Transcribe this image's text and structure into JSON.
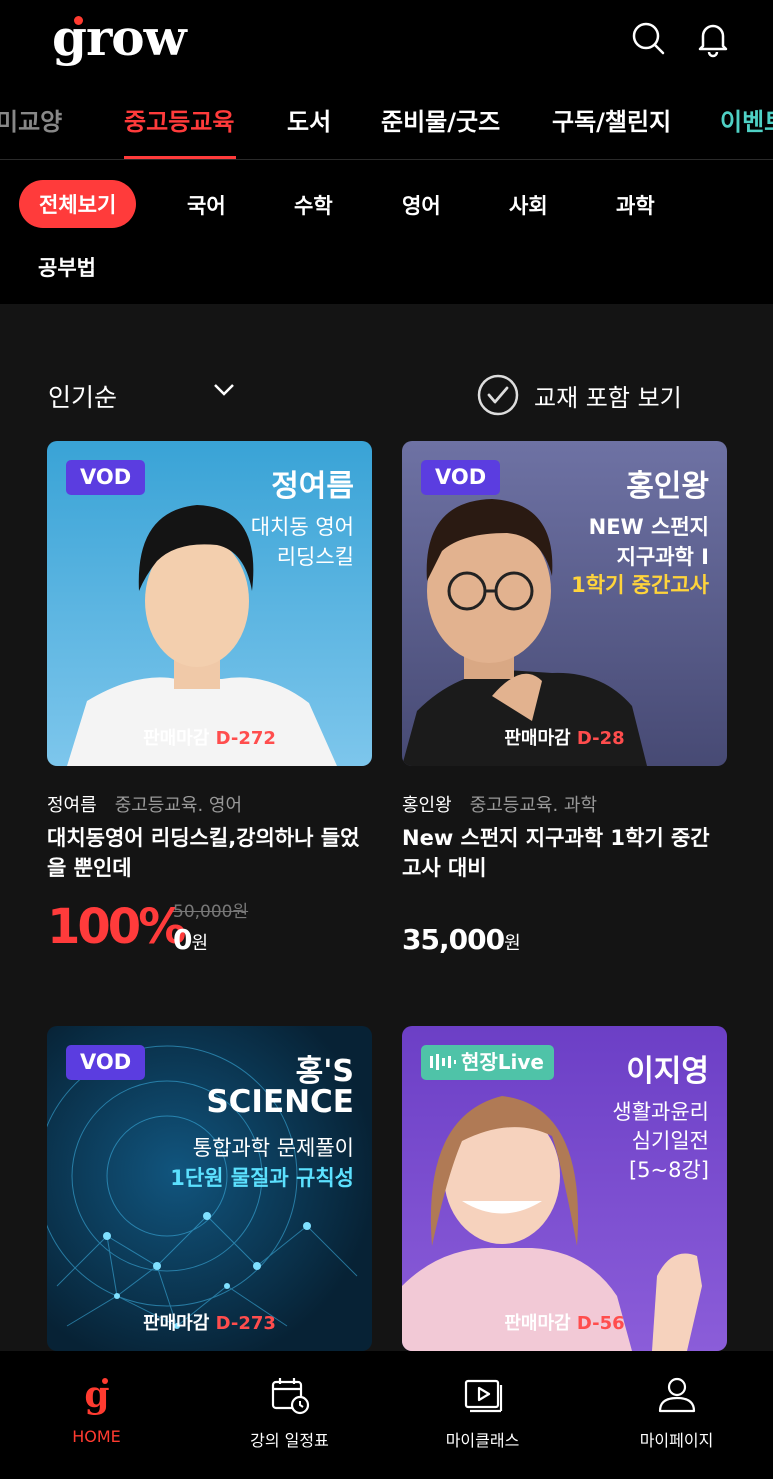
{
  "header": {
    "logo": "grow",
    "icons": [
      "search-icon",
      "bell-icon"
    ]
  },
  "category_tabs": [
    {
      "label": "미교양",
      "state": "dim"
    },
    {
      "label": "중고등교육",
      "state": "active"
    },
    {
      "label": "도서",
      "state": "normal"
    },
    {
      "label": "준비물/굿즈",
      "state": "normal"
    },
    {
      "label": "구독/챌린지",
      "state": "normal"
    },
    {
      "label": "이벤트",
      "state": "event"
    }
  ],
  "subject_chips": [
    "전체보기",
    "국어",
    "수학",
    "영어",
    "사회",
    "과학",
    "공부법"
  ],
  "filters": {
    "sort_label": "인기순",
    "include_textbook_label": "교재 포함 보기"
  },
  "products": [
    {
      "badge": "VOD",
      "thumb_name": "정여름",
      "thumb_lines": [
        "대치동 영어",
        "리딩스킬"
      ],
      "deadline_label": "판매마감",
      "deadline": "D-272",
      "instructor": "정여름",
      "category": "중고등교육. 영어",
      "title": "대치동영어 리딩스킬,강의하나 들었을 뿐인데",
      "discount": "100%",
      "original_price": "50,000원",
      "price": "0",
      "currency": "원",
      "colors": {
        "bg_top": "#3fa9d8",
        "bg_bottom": "#7cc8ee"
      }
    },
    {
      "badge": "VOD",
      "thumb_name": "홍인왕",
      "thumb_lines": [
        "NEW 스펀지",
        "지구과학 I",
        "1학기 중간고사"
      ],
      "deadline_label": "판매마감",
      "deadline": "D-28",
      "instructor": "홍인왕",
      "category": "중고등교육. 과학",
      "title": "New 스펀지 지구과학 1학기 중간고사 대비",
      "price": "35,000",
      "currency": "원",
      "colors": {
        "bg_top": "#6a6d9e",
        "bg_bottom": "#4a4c78"
      }
    },
    {
      "badge": "VOD",
      "thumb_name": "홍'S",
      "thumb_lines": [
        "SCIENCE",
        "통합과학 문제풀이",
        "1단원 물질과 규칙성"
      ],
      "deadline_label": "판매마감",
      "deadline": "D-273",
      "colors": {
        "bg_top": "#0b3a5c",
        "bg_bottom": "#0a2540"
      }
    },
    {
      "badge": "현장Live",
      "thumb_name": "이지영",
      "thumb_lines": [
        "생활과윤리",
        "심기일전",
        "[5~8강]"
      ],
      "deadline_label": "판매마감",
      "deadline": "D-56",
      "colors": {
        "bg_top": "#6d3fc4",
        "bg_bottom": "#8a5ad8"
      }
    }
  ],
  "bottom_nav": [
    {
      "label": "HOME",
      "icon": "home-g-icon",
      "active": true
    },
    {
      "label": "강의 일정표",
      "icon": "calendar-clock-icon",
      "active": false
    },
    {
      "label": "마이클래스",
      "icon": "play-box-icon",
      "active": false
    },
    {
      "label": "마이페이지",
      "icon": "user-icon",
      "active": false
    }
  ],
  "accent_color": "#ff3b3b"
}
